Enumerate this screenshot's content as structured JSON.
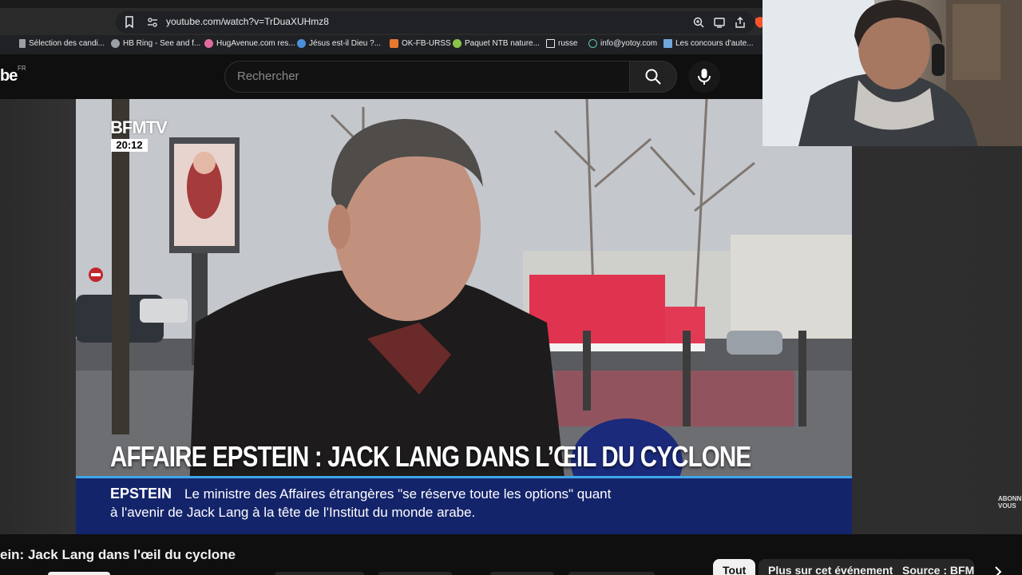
{
  "browser": {
    "url": "youtube.com/watch?v=TrDuaXUHmz8",
    "bookmarks": [
      {
        "label": "Sélection des candi...",
        "icon": "file-icon"
      },
      {
        "label": "HB Ring - See and f...",
        "icon": "globe-icon"
      },
      {
        "label": "HugAvenue.com res...",
        "icon": "heart-icon"
      },
      {
        "label": "Jésus est-il Dieu ?...",
        "icon": "globe-icon"
      },
      {
        "label": "OK-FB-URSS",
        "icon": "orange-icon"
      },
      {
        "label": "Paquet NTB nature...",
        "icon": "leaf-icon"
      },
      {
        "label": "russe",
        "icon": "folder-icon"
      },
      {
        "label": "info@yotoy.com",
        "icon": "mail-icon"
      },
      {
        "label": "Les concours d'aute...",
        "icon": "image-icon"
      }
    ]
  },
  "youtube": {
    "logo_partial": "be",
    "region": "FR",
    "search_placeholder": "Rechercher"
  },
  "video": {
    "channel_logo": "BFMTV",
    "clock": "20:12",
    "headline": "AFFAIRE EPSTEIN : JACK LANG DANS L’ŒIL DU CYCLONE",
    "ticker_label": "EPSTEIN",
    "ticker_line1": "Le ministre des Affaires étrangères \"se réserve toute les options\" quant",
    "ticker_line2": "à l'avenir de Jack Lang à la tête de l'Institut du monde arabe.",
    "subscribe_overlay_line1": "ABONN",
    "subscribe_overlay_line2": "VOUS"
  },
  "below": {
    "title": "ein: Jack Lang dans l'œil du cyclone",
    "chips": [
      "Tout",
      "Plus sur cet événement",
      "Source : BFMTV"
    ]
  },
  "colors": {
    "ticker_bg": "#14246b",
    "ticker_border": "#3ea6e8",
    "page_bg": "#0f0f0f"
  }
}
